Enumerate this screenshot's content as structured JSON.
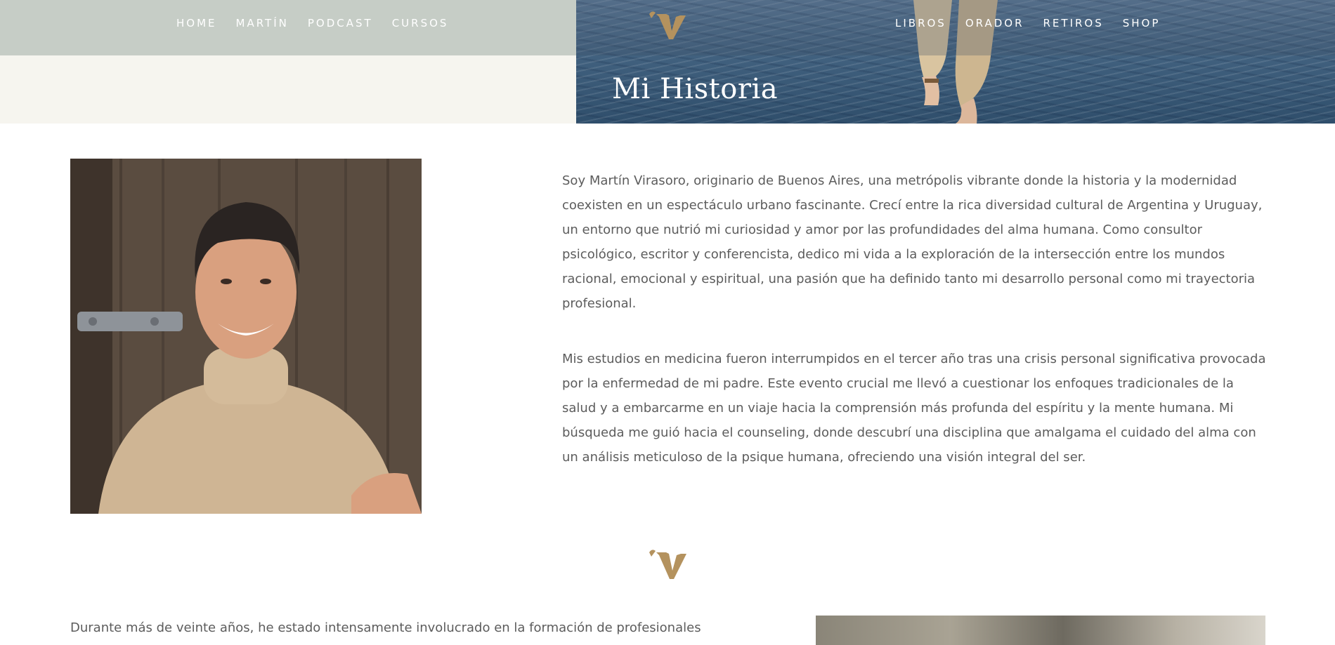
{
  "nav": {
    "left_items": [
      "HOME",
      "MARTÍN",
      "PODCAST",
      "CURSOS"
    ],
    "right_items": [
      "LIBROS",
      "ORADOR",
      "RETIROS",
      "SHOP"
    ]
  },
  "brand": {
    "logo_letter": "V",
    "logo_color": "#b4925e"
  },
  "hero": {
    "title": "Mi Historia"
  },
  "bio": {
    "paragraphs": [
      "Soy Martín Virasoro, originario de Buenos Aires, una metrópolis vibrante donde la historia y la modernidad coexisten en un espectáculo urbano fascinante. Crecí entre la rica diversidad cultural de Argentina y Uruguay, un entorno que nutrió mi curiosidad y amor por las profundidades del alma humana. Como consultor psicológico, escritor y conferencista, dedico mi vida a la exploración de la intersección entre los mundos racional, emocional y espiritual, una pasión que ha definido tanto mi desarrollo personal como mi trayectoria profesional.",
      "Mis estudios en medicina fueron interrumpidos en el tercer año tras una crisis personal significativa provocada por la enfermedad de mi padre. Este evento crucial me llevó a cuestionar los enfoques tradicionales de la salud y a embarcarme en un viaje hacia la comprensión más profunda del espíritu y la mente humana. Mi búsqueda me guió hacia el counseling, donde descubrí una disciplina que amalgama el cuidado del alma con un análisis meticuloso de la psique humana, ofreciendo una visión integral del ser."
    ]
  },
  "section2": {
    "paragraph_start": "Durante más de veinte años, he estado intensamente involucrado en la formación de profesionales"
  },
  "colors": {
    "nav_left_bg": "#c6cdc6",
    "hero_left_bg": "#f6f5ef",
    "body_text": "#5c5c5c"
  }
}
